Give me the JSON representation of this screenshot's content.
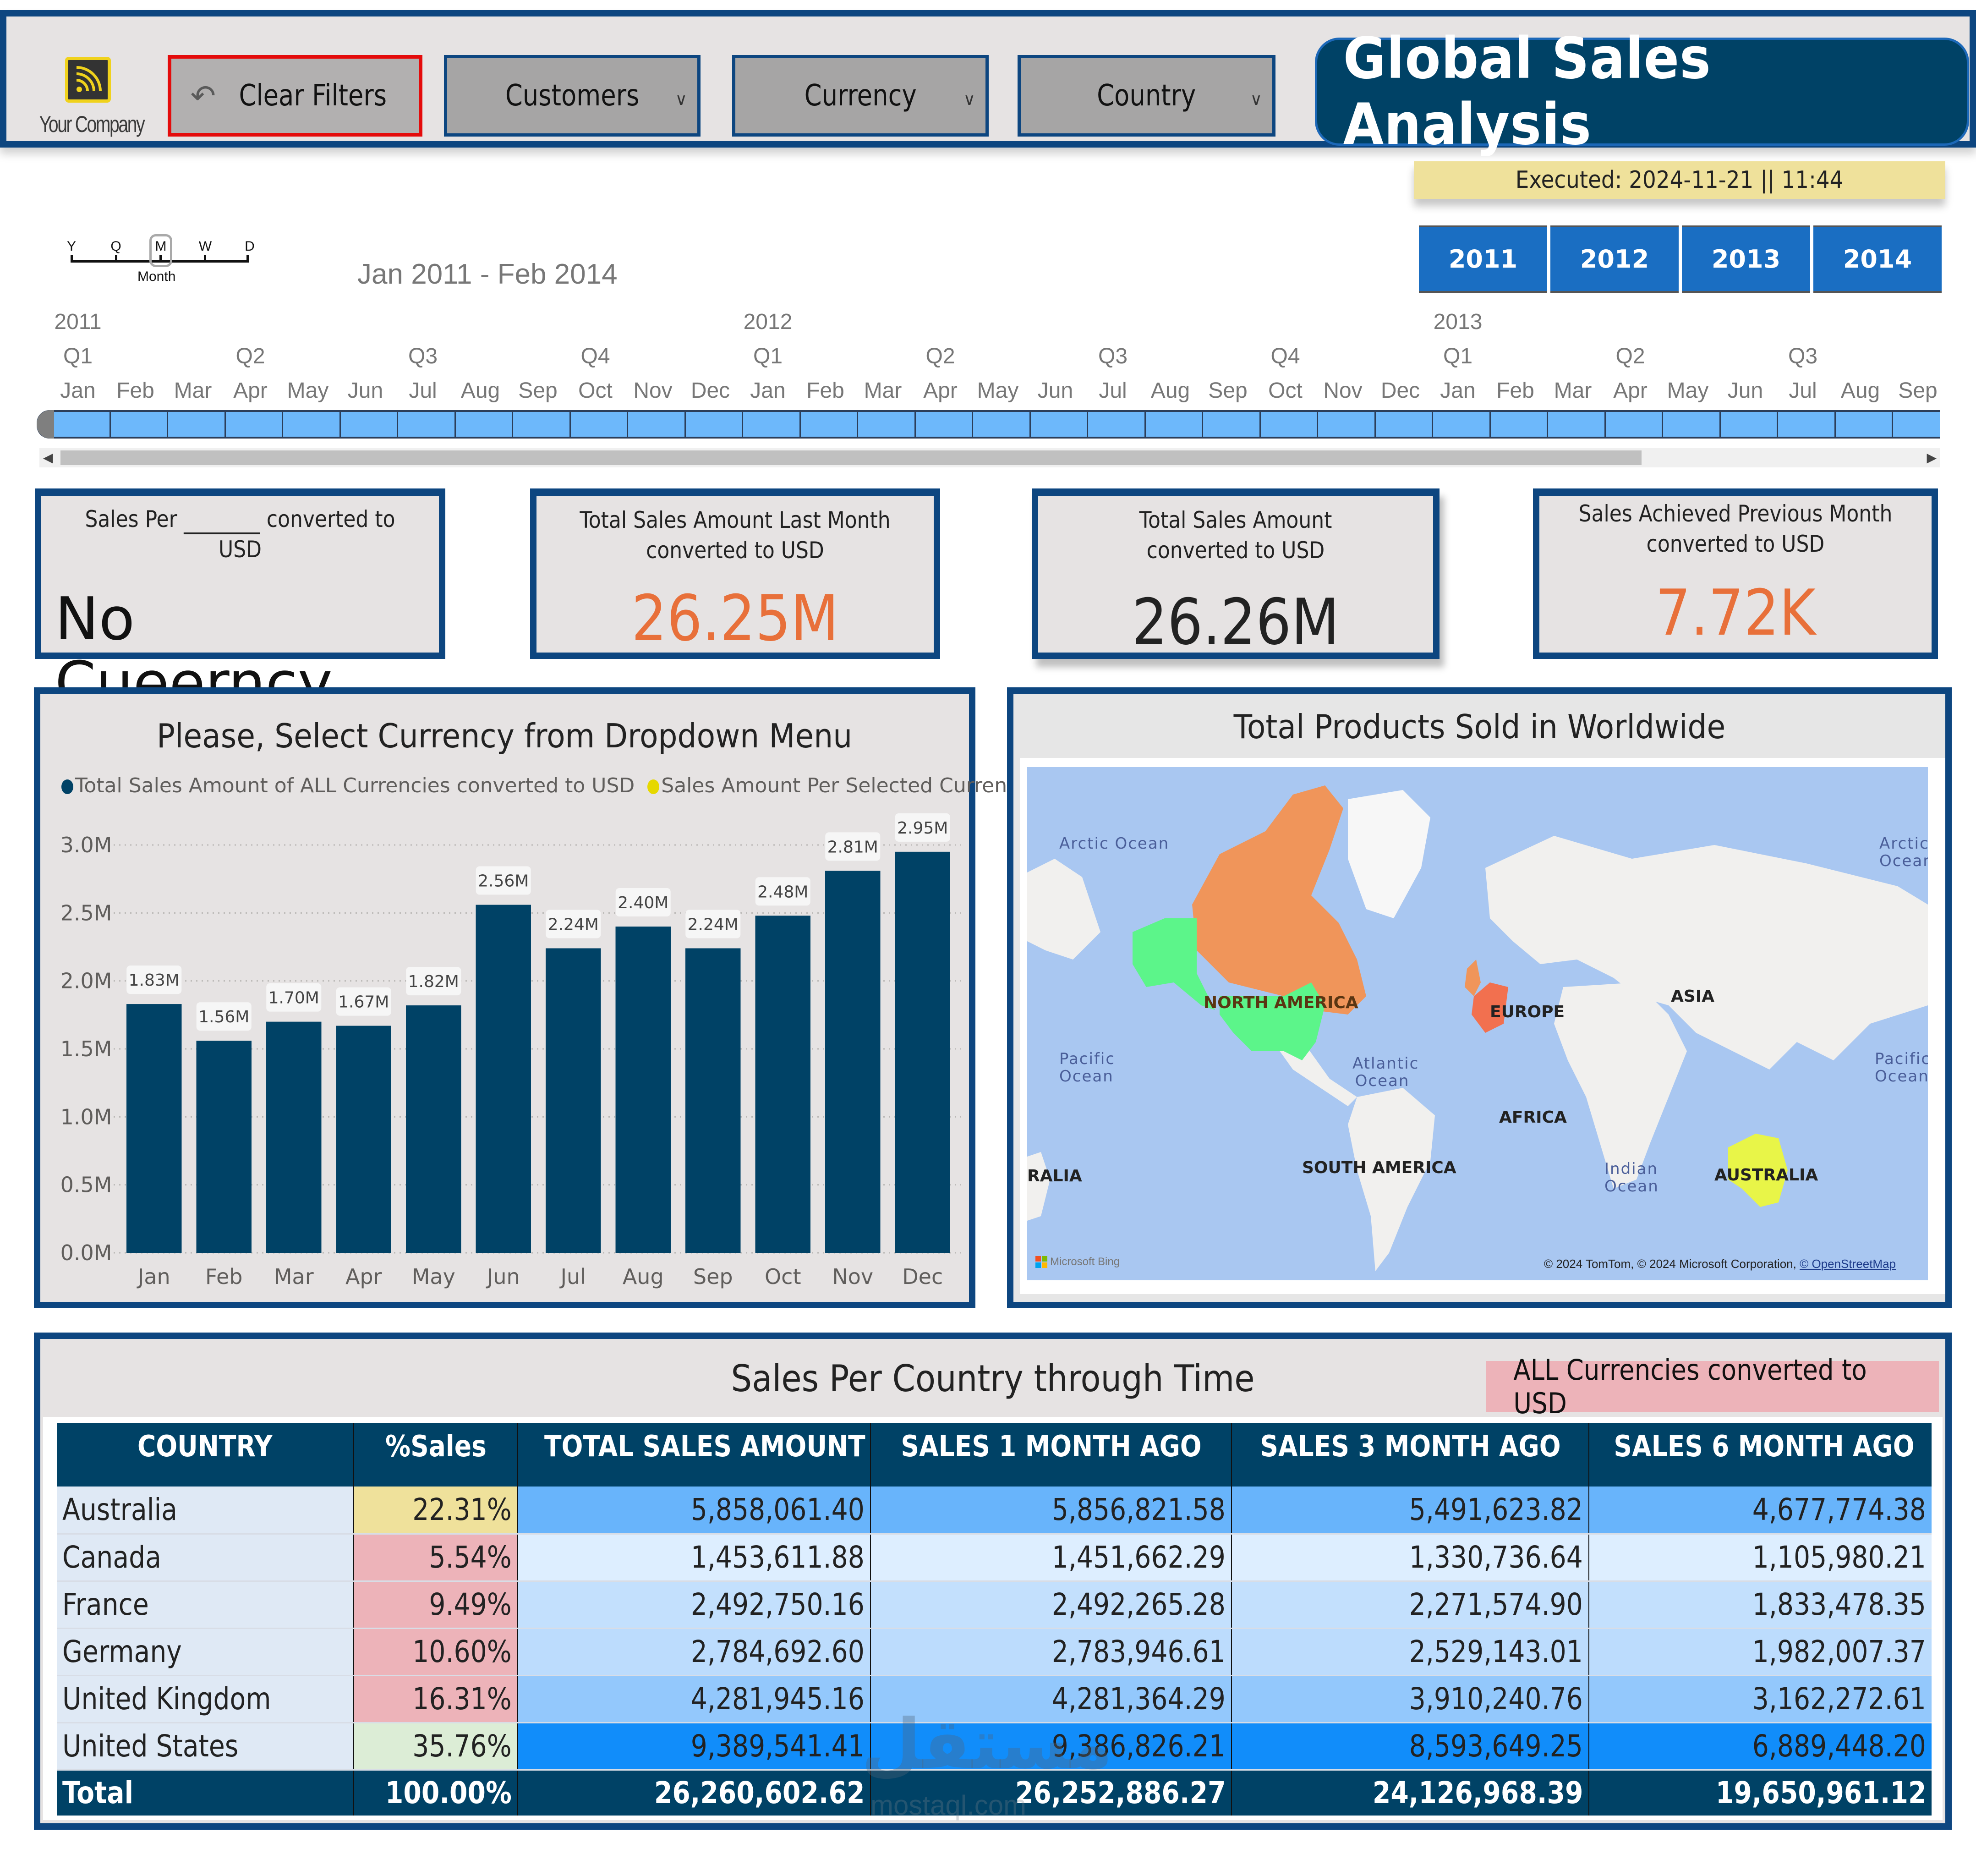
{
  "header": {
    "logo_text": "Your Company",
    "clear_filters_label": "Clear Filters",
    "dropdowns": [
      {
        "label": "Customers"
      },
      {
        "label": "Currency"
      },
      {
        "label": "Country"
      }
    ],
    "title": "Global Sales Analysis"
  },
  "executed": "Executed: 2024-11-21  ||  11:44",
  "year_buttons": [
    "2011",
    "2012",
    "2013",
    "2014"
  ],
  "date_slicer": {
    "granularity_letters": [
      "Y",
      "Q",
      "M",
      "W",
      "D"
    ],
    "granularity_selected": "M",
    "granularity_name": "Month",
    "range_text": "Jan 2011 - Feb 2014",
    "years": [
      "2011",
      "2012",
      "2013"
    ],
    "quarters": [
      "Q1",
      "Q2",
      "Q3",
      "Q4",
      "Q1",
      "Q2",
      "Q3",
      "Q4",
      "Q1",
      "Q2",
      "Q3"
    ],
    "months": [
      "Jan",
      "Feb",
      "Mar",
      "Apr",
      "May",
      "Jun",
      "Jul",
      "Aug",
      "Sep",
      "Oct",
      "Nov",
      "Dec",
      "Jan",
      "Feb",
      "Mar",
      "Apr",
      "May",
      "Jun",
      "Jul",
      "Aug",
      "Sep",
      "Oct",
      "Nov",
      "Dec",
      "Jan",
      "Feb",
      "Mar",
      "Apr",
      "May",
      "Jun",
      "Jul",
      "Aug",
      "Sep"
    ],
    "scroll_position_fraction": 0.85
  },
  "kpis": [
    {
      "title_a": "Sales Per ",
      "title_b": " converted to",
      "title_c": "USD",
      "value": "No Cueerncy..."
    },
    {
      "title": "Total Sales Amount Last Month converted to USD",
      "value": "26.25M"
    },
    {
      "title": "Total Sales Amount converted to USD",
      "value": "26.26M"
    },
    {
      "title": "Sales Achieved Previous Month converted to USD",
      "value": "7.72K"
    }
  ],
  "colors": {
    "navy": "#004266",
    "border_blue": "#0d4680",
    "kpi_orange": "#e8703a",
    "legend_yellow": "#e6d800",
    "map_canada": "#f0955a",
    "map_usa": "#5cf58a",
    "map_europe": "#f2704f",
    "map_australia": "#e8f548"
  },
  "chart_data": {
    "type": "bar",
    "title": "Please, Select Currency from Dropdown Menu",
    "legend": [
      {
        "name": "Total Sales Amount of ALL Currencies converted to USD",
        "color": "#004266"
      },
      {
        "name": "Sales Amount Per Selected Currency",
        "color": "#e6d800"
      }
    ],
    "legend_position": "top-left",
    "categories": [
      "Jan",
      "Feb",
      "Mar",
      "Apr",
      "May",
      "Jun",
      "Jul",
      "Aug",
      "Sep",
      "Oct",
      "Nov",
      "Dec"
    ],
    "series": [
      {
        "name": "Total Sales Amount of ALL Currencies converted to USD",
        "values": [
          1.83,
          1.56,
          1.7,
          1.67,
          1.82,
          2.56,
          2.24,
          2.4,
          2.24,
          2.48,
          2.81,
          2.95
        ],
        "labels": [
          "1.83M",
          "1.56M",
          "1.70M",
          "1.67M",
          "1.82M",
          "2.56M",
          "2.24M",
          "2.40M",
          "2.24M",
          "2.48M",
          "2.81M",
          "2.95M"
        ]
      }
    ],
    "yticks": [
      "0.0M",
      "0.5M",
      "1.0M",
      "1.5M",
      "2.0M",
      "2.5M",
      "3.0M"
    ],
    "ylim": [
      0,
      3.0
    ],
    "yunit": "M",
    "xlabel": "",
    "ylabel": "",
    "grid": true
  },
  "map": {
    "title": "Total Products Sold in Worldwide",
    "continents": [
      "NORTH AMERICA",
      "EUROPE",
      "ASIA",
      "AFRICA",
      "SOUTH AMERICA",
      "AUSTRALIA",
      "RALIA"
    ],
    "oceans": [
      "Arctic Ocean",
      "Arctic Ocean",
      "Pacific Ocean",
      "Atlantic Ocean",
      "Pacific Ocean",
      "Indian Ocean"
    ],
    "provider": "Microsoft Bing",
    "attribution": "© 2024 TomTom, © 2024 Microsoft Corporation, ",
    "attribution_link": "© OpenStreetMap"
  },
  "table": {
    "title": "Sales Per Country through Time",
    "badge": "ALL Currencies converted to USD",
    "columns": [
      "COUNTRY",
      "%Sales",
      "TOTAL SALES AMOUNT",
      "SALES 1 MONTH AGO",
      "SALES 3 MONTH AGO",
      "SALES 6 MONTH AGO"
    ],
    "rows": [
      {
        "country": "Australia",
        "pct": "22.31%",
        "total": "5,858,061.40",
        "m1": "5,856,821.58",
        "m3": "5,491,623.82",
        "m6": "4,677,774.38",
        "pct_color": "#efe19b",
        "val_color": "#68b4fb"
      },
      {
        "country": "Canada",
        "pct": "5.54%",
        "total": "1,453,611.88",
        "m1": "1,451,662.29",
        "m3": "1,330,736.64",
        "m6": "1,105,980.21",
        "pct_color": "#edb3b9",
        "val_color": "#ddeeff"
      },
      {
        "country": "France",
        "pct": "9.49%",
        "total": "2,492,750.16",
        "m1": "2,492,265.28",
        "m3": "2,271,574.90",
        "m6": "1,833,478.35",
        "pct_color": "#edb3b9",
        "val_color": "#c3e0fd"
      },
      {
        "country": "Germany",
        "pct": "10.60%",
        "total": "2,784,692.60",
        "m1": "2,783,946.61",
        "m3": "2,529,143.01",
        "m6": "1,982,007.37",
        "pct_color": "#edb3b9",
        "val_color": "#bcdcfd"
      },
      {
        "country": "United Kingdom",
        "pct": "16.31%",
        "total": "4,281,945.16",
        "m1": "4,281,364.29",
        "m3": "3,910,240.76",
        "m6": "3,162,272.61",
        "pct_color": "#edb3b9",
        "val_color": "#93c8fc"
      },
      {
        "country": "United States",
        "pct": "35.76%",
        "total": "9,389,541.41",
        "m1": "9,386,826.21",
        "m3": "8,593,649.25",
        "m6": "6,889,448.20",
        "pct_color": "#dcedd6",
        "val_color": "#118dfa"
      }
    ],
    "total": {
      "country": "Total",
      "pct": "100.00%",
      "total": "26,260,602.62",
      "m1": "26,252,886.27",
      "m3": "24,126,968.39",
      "m6": "19,650,961.12"
    }
  },
  "watermark": {
    "arabic": "مستقل",
    "latin": "mostaql.com"
  }
}
